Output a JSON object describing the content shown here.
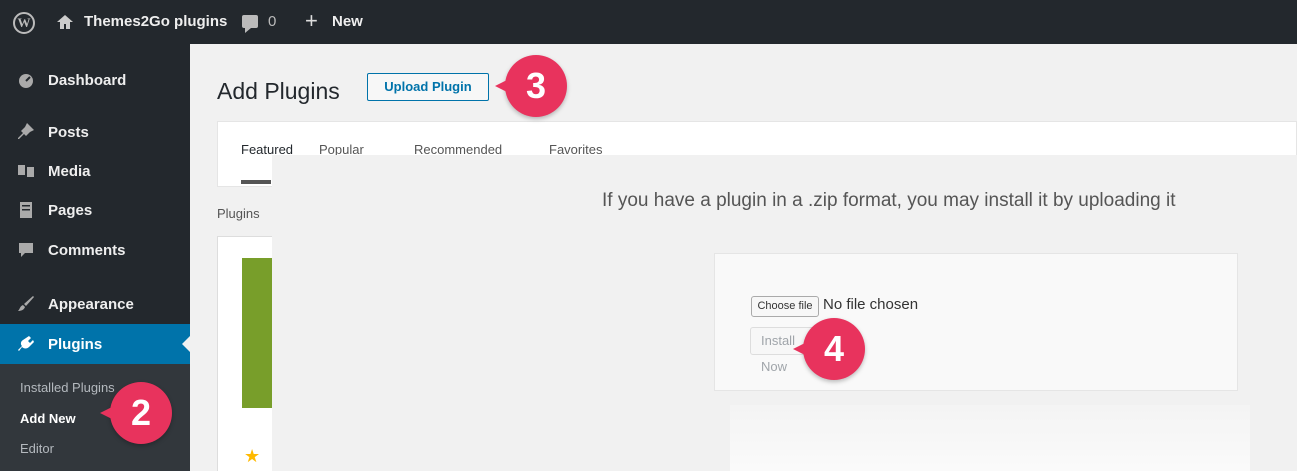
{
  "adminbar": {
    "site_name": "Themes2Go plugins",
    "comment_count": "0",
    "new_label": "New"
  },
  "sidebar": {
    "items": [
      {
        "label": "Dashboard",
        "icon": "dashboard-icon"
      },
      {
        "label": "Posts",
        "icon": "pin-icon"
      },
      {
        "label": "Media",
        "icon": "media-icon"
      },
      {
        "label": "Pages",
        "icon": "pages-icon"
      },
      {
        "label": "Comments",
        "icon": "comment-icon"
      },
      {
        "label": "Appearance",
        "icon": "brush-icon"
      },
      {
        "label": "Plugins",
        "icon": "plug-icon"
      }
    ],
    "submenu": [
      "Installed Plugins",
      "Add New",
      "Editor"
    ]
  },
  "page": {
    "title": "Add Plugins",
    "upload_button": "Upload Plugin",
    "tabs": [
      "Featured",
      "Popular",
      "Recommended",
      "Favorites"
    ],
    "plugins_label": "Plugins"
  },
  "upload": {
    "help_text": "If you have a plugin in a .zip format, you may install it by uploading it",
    "choose_file": "Choose file",
    "no_file": "No file chosen",
    "install_button": "Install Now"
  },
  "badges": [
    "2",
    "3",
    "4"
  ],
  "colors": {
    "adminbar": "#23282d",
    "active_menu": "#0073aa",
    "badge": "#e8335d",
    "thumb": "#789e2a"
  }
}
